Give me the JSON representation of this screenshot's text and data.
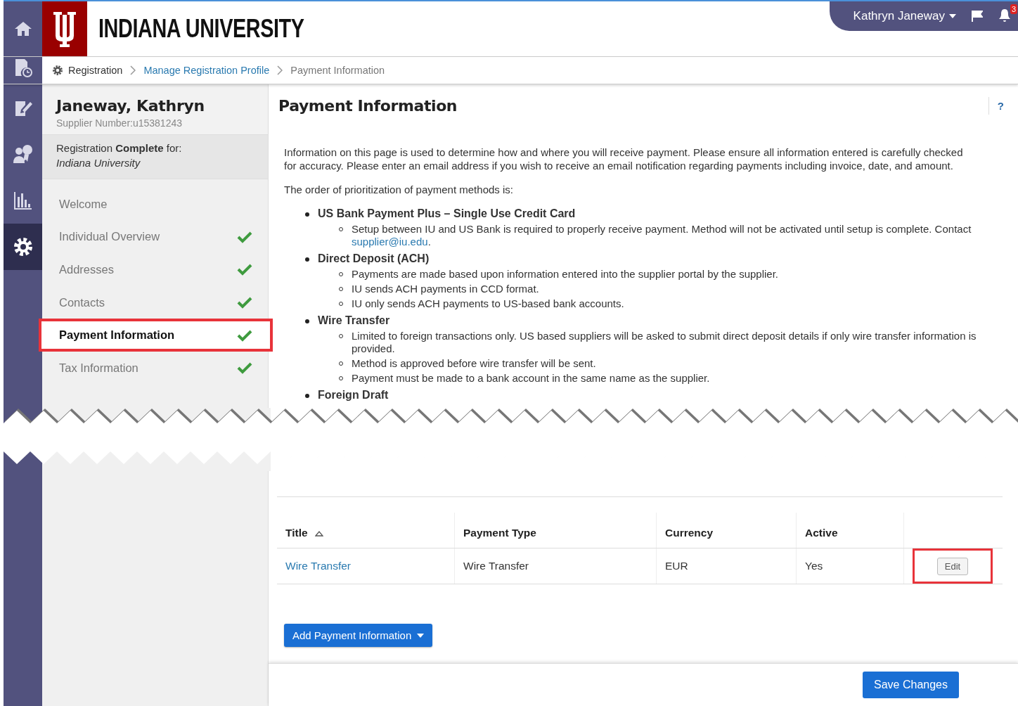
{
  "rail": {
    "items": [
      {
        "selected": false
      },
      {
        "selected": false
      },
      {
        "selected": false
      },
      {
        "selected": false
      },
      {
        "selected": false
      },
      {
        "selected": true
      }
    ]
  },
  "header": {
    "title": "INDIANA UNIVERSITY",
    "user": "Kathryn Janeway",
    "notification_count": "3"
  },
  "breadcrumb": [
    {
      "label": "Registration",
      "kind": "root"
    },
    {
      "label": "Manage Registration Profile",
      "kind": "link"
    },
    {
      "label": "Payment Information",
      "kind": "current"
    }
  ],
  "profile": {
    "name": "Janeway, Kathryn",
    "supplier_number": "Supplier Number:u15381243",
    "status": "Registration **Complete** for:",
    "organization": "Indiana University"
  },
  "nav": {
    "items": [
      {
        "label": "Welcome",
        "selected": false,
        "completed": false
      },
      {
        "label": "Individual Overview",
        "selected": false,
        "completed": true
      },
      {
        "label": "Addresses",
        "selected": false,
        "completed": true
      },
      {
        "label": "Contacts",
        "selected": false,
        "completed": true
      },
      {
        "label": "Payment Information",
        "selected": true,
        "completed": true
      },
      {
        "label": "Tax Information",
        "selected": false,
        "completed": true
      }
    ]
  },
  "main": {
    "title": "Payment Information",
    "help": "?",
    "intro": "Information on this page is used to determine how and where you will receive payment. Please ensure all information entered is carefully checked for accuracy. Please enter an email address if you wish to receive an email notification regarding payments including invoice, date, and amount.",
    "order_label": "The order of prioritization of payment methods is:",
    "methods": [
      {
        "name": "US Bank Payment Plus – Single Use Credit Card",
        "details": [
          {
            "text": "Setup between IU and US Bank is required to properly receive payment. Method will not be activated until setup is complete. Contact ",
            "link": "supplier@iu.edu",
            "tail": "."
          }
        ]
      },
      {
        "name": "Direct Deposit (ACH)",
        "details": [
          {
            "text": "Payments are made based upon information entered into the supplier portal by the supplier."
          },
          {
            "text": "IU sends ACH payments in CCD format."
          },
          {
            "text": "IU only sends ACH payments to US-based bank accounts."
          }
        ]
      },
      {
        "name": "Wire Transfer",
        "details": [
          {
            "text": "Limited to foreign transactions only. US based suppliers will be asked to submit direct deposit details if only wire transfer information is provided."
          },
          {
            "text": "Method is approved before wire transfer will be sent."
          },
          {
            "text": "Payment must be made to a bank account in the same name as the supplier."
          }
        ]
      },
      {
        "name": "Foreign Draft"
      }
    ]
  },
  "table": {
    "columns": [
      {
        "label": "Title",
        "sorted": true
      },
      {
        "label": "Payment Type",
        "sorted": false
      },
      {
        "label": "Currency",
        "sorted": false
      },
      {
        "label": "Active",
        "sorted": false
      }
    ],
    "rows": [
      {
        "title": "Wire Transfer",
        "payment_type": "Wire Transfer",
        "currency": "EUR",
        "active": "Yes",
        "action": "Edit",
        "highlighted": true
      }
    ]
  },
  "add_button": "Add Payment Information",
  "save_button": "Save Changes"
}
